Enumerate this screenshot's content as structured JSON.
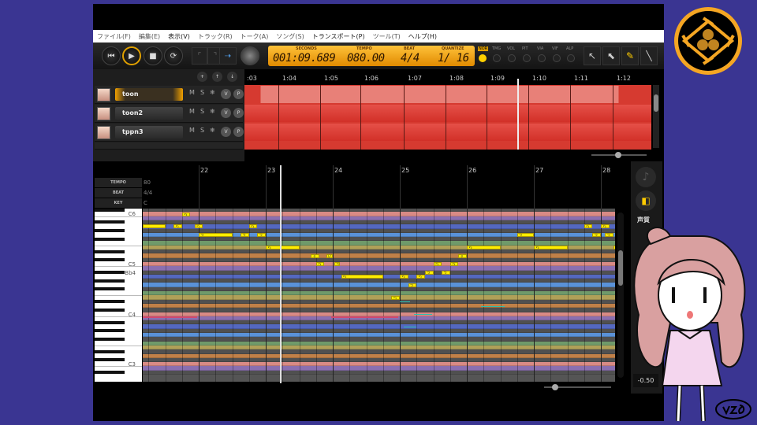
{
  "menu": [
    "ファイル(F)",
    "編集(E)",
    "表示(V)",
    "トラック(R)",
    "トーク(A)",
    "ソング(S)",
    "トランスポート(P)",
    "ツール(T)",
    "ヘルプ(H)"
  ],
  "transport": {
    "labels": {
      "seconds": "SECONDS",
      "tempo": "TEMPO",
      "beat": "BEAT",
      "quantize": "QUANTIZE"
    },
    "seconds": "001:09.689",
    "tempo": "080.00",
    "beat": "4/4",
    "quantize": "1/ 16"
  },
  "params": [
    "NOR",
    "TMG",
    "VOL",
    "PIT",
    "VIA",
    "VIF",
    "ALP"
  ],
  "tracks": [
    {
      "name": "toon",
      "selected": true
    },
    {
      "name": "toon2"
    },
    {
      "name": "tppn3"
    }
  ],
  "track_buttons": {
    "m": "M",
    "s": "S",
    "freeze": "❄",
    "v": "V",
    "p": "P"
  },
  "timeline": [
    ":03",
    "1:04",
    "1:05",
    "1:06",
    "1:07",
    "1:08",
    "1:09",
    "1:10",
    "1:11",
    "1:12"
  ],
  "roll": {
    "header_labels": [
      "TEMPO",
      "BEAT",
      "KEY"
    ],
    "tempo": "80",
    "beat": "4/4",
    "key": "C",
    "measures": [
      "22",
      "23",
      "24",
      "25",
      "26",
      "27",
      "28"
    ],
    "key_labels": [
      "C6",
      "C5",
      "Bb4",
      "C4",
      "C3"
    ]
  },
  "side": {
    "voice_label": "声質",
    "value": "-0.50"
  },
  "notes": [
    {
      "b": -3.34,
      "len": 1.36,
      "p": 81,
      "l": ""
    },
    {
      "b": -1.5,
      "len": 0.5,
      "p": 81,
      "l": "ら"
    },
    {
      "b": -1,
      "len": 0.5,
      "p": 84,
      "l": "ち"
    },
    {
      "b": -0.25,
      "len": 0.5,
      "p": 81,
      "l": "ら"
    },
    {
      "b": 0,
      "len": 2,
      "p": 79,
      "l": "う"
    },
    {
      "b": 2.5,
      "len": 0.5,
      "p": 79,
      "l": "う"
    },
    {
      "b": 3,
      "len": 0.5,
      "p": 81,
      "l": "ら"
    },
    {
      "b": 3.5,
      "len": 0.5,
      "p": 79,
      "l": "う"
    },
    {
      "b": 4,
      "len": 2,
      "p": 76,
      "l": "ち"
    },
    {
      "b": 6.7,
      "len": 0.5,
      "p": 74,
      "l": "ず"
    },
    {
      "b": 7,
      "len": 0.5,
      "p": 72,
      "l": "ち"
    },
    {
      "b": 7.6,
      "len": 0.4,
      "p": 74,
      "l": "い"
    },
    {
      "b": 8.1,
      "len": 0.3,
      "p": 72,
      "l": "ち"
    },
    {
      "b": 8.5,
      "len": 2.5,
      "p": 69,
      "l": "ら"
    },
    {
      "b": 11.5,
      "len": 0.5,
      "p": 64,
      "l": "ち"
    },
    {
      "b": 12,
      "len": 0.5,
      "p": 69,
      "l": "ら"
    },
    {
      "b": 12.5,
      "len": 0.5,
      "p": 67,
      "l": "う"
    },
    {
      "b": 13,
      "len": 0.5,
      "p": 69,
      "l": "ら"
    },
    {
      "b": 13.5,
      "len": 0.5,
      "p": 70,
      "l": "う"
    },
    {
      "b": 14,
      "len": 0.5,
      "p": 72,
      "l": "ち"
    },
    {
      "b": 14.5,
      "len": 0.5,
      "p": 70,
      "l": "う"
    },
    {
      "b": 15,
      "len": 0.5,
      "p": 72,
      "l": "ち"
    },
    {
      "b": 15.5,
      "len": 0.5,
      "p": 74,
      "l": "ず"
    },
    {
      "b": 16,
      "len": 2,
      "p": 76,
      "l": "ち"
    },
    {
      "b": 19,
      "len": 1,
      "p": 79,
      "l": "う"
    },
    {
      "b": 20,
      "len": 2,
      "p": 76,
      "l": "ち"
    },
    {
      "b": 23,
      "len": 0.5,
      "p": 81,
      "l": "ら"
    },
    {
      "b": 23.5,
      "len": 0.5,
      "p": 79,
      "l": "う"
    },
    {
      "b": 24,
      "len": 0.5,
      "p": 81,
      "l": "ら"
    },
    {
      "b": 24.25,
      "len": 0.5,
      "p": 79,
      "l": "う"
    },
    {
      "b": 24.75,
      "len": 0.5,
      "p": 76,
      "l": "ち"
    }
  ],
  "colors": {
    "bg": "#3a3592",
    "lcd": "#ffb020",
    "note": "#ffee00",
    "track": "#d63a30"
  }
}
